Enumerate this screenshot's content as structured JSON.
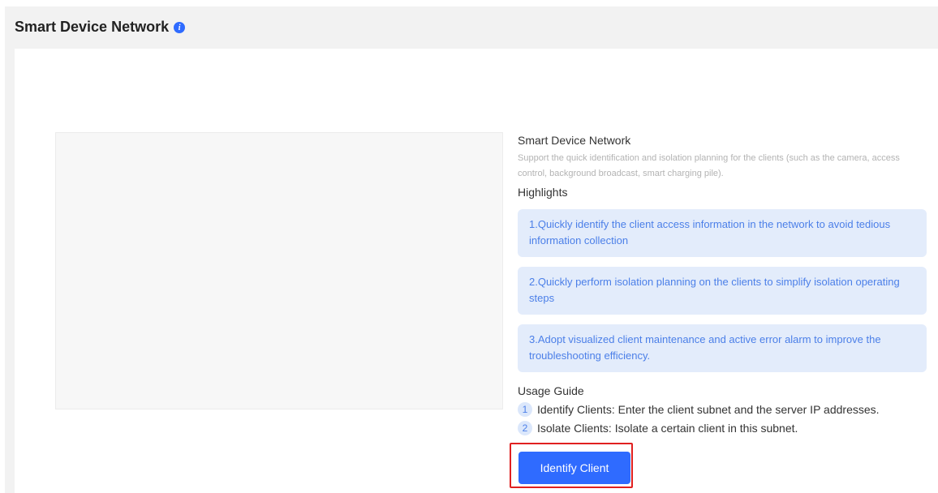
{
  "header": {
    "title": "Smart Device Network",
    "info_icon": "info-icon"
  },
  "feature": {
    "title": "Smart Device Network",
    "description": "Support the quick identification and isolation planning for the clients (such as the camera, access control, background broadcast, smart charging pile)."
  },
  "highlights": {
    "title": "Highlights",
    "items": [
      "1.Quickly identify the client access information in the network to avoid tedious information collection",
      "2.Quickly perform isolation planning on the clients to simplify isolation operating steps",
      "3.Adopt visualized client maintenance and active error alarm to improve the troubleshooting efficiency."
    ]
  },
  "guide": {
    "title": "Usage Guide",
    "steps": [
      {
        "num": "1",
        "text": "Identify Clients: Enter the client subnet and the server IP addresses."
      },
      {
        "num": "2",
        "text": "Isolate Clients: Isolate a certain client in this subnet."
      }
    ]
  },
  "actions": {
    "identify_label": "Identify Client"
  },
  "colors": {
    "accent": "#2f6bff",
    "highlight_bg": "#e3ecfb",
    "highlight_text": "#4b7fe8",
    "focus_border": "#e02020"
  }
}
